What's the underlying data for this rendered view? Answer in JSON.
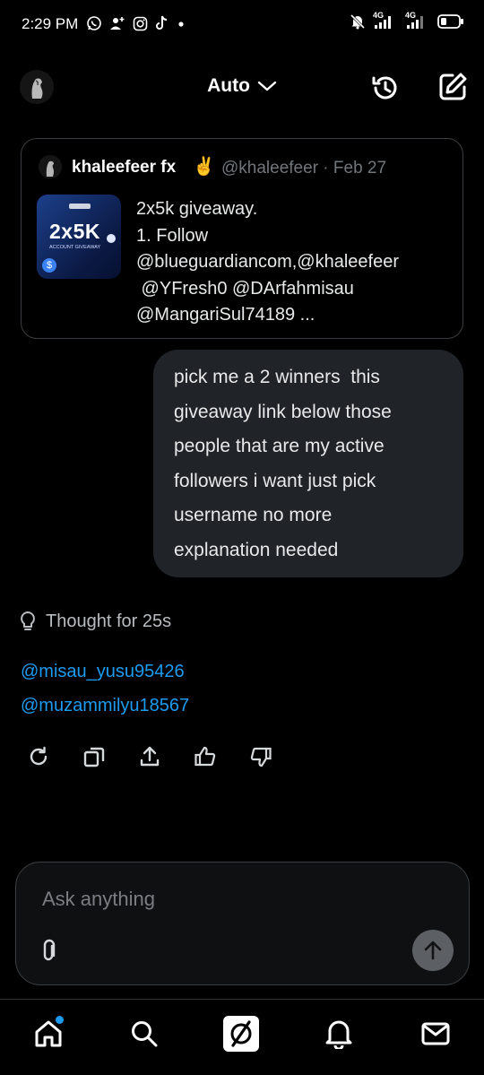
{
  "status_bar": {
    "time": "2:29 PM",
    "icons_left": [
      "whatsapp-icon",
      "add-person-icon",
      "instagram-icon",
      "tiktok-icon",
      "dot-icon"
    ],
    "icons_right": [
      "mute-icon",
      "signal-4g-icon",
      "signal-4g-icon",
      "battery-icon"
    ],
    "network_1": "4G",
    "network_2": "4G"
  },
  "header": {
    "mode_label": "Auto",
    "icons": [
      "history-icon",
      "compose-icon"
    ]
  },
  "quoted_post": {
    "author_name": "khaleefeer fx",
    "author_emoji": "✌",
    "handle_date": "@khaleefeer · Feb 27",
    "thumb_title": "2x5K",
    "thumb_sub": "ACCOUNT GIVEAWAY",
    "lines": [
      "2x5k giveaway.",
      "1. Follow",
      "@blueguardiancom,@khaleefeer",
      " @YFresh0 @DArfahmisau",
      "@MangariSul74189 ..."
    ]
  },
  "user_message": {
    "lines": [
      "pick me a 2 winners  this",
      "giveaway link below those",
      "people that are my active",
      "followers i want just pick",
      "username no more",
      "explanation needed"
    ]
  },
  "assistant": {
    "thought_label": "Thought for 25s",
    "answers": [
      "@misau_yusu95426",
      "@muzammilyu18567"
    ],
    "action_icons": [
      "regenerate-icon",
      "copy-icon",
      "share-icon",
      "thumbs-up-icon",
      "thumbs-down-icon"
    ]
  },
  "composer": {
    "placeholder": "Ask anything"
  },
  "bottom_nav": {
    "items": [
      "home-icon",
      "search-icon",
      "grok-icon",
      "notifications-icon",
      "messages-icon"
    ]
  },
  "colors": {
    "background": "#000000",
    "accent": "#1d9bf0",
    "bubble": "#202327",
    "border": "#3a3d41"
  }
}
